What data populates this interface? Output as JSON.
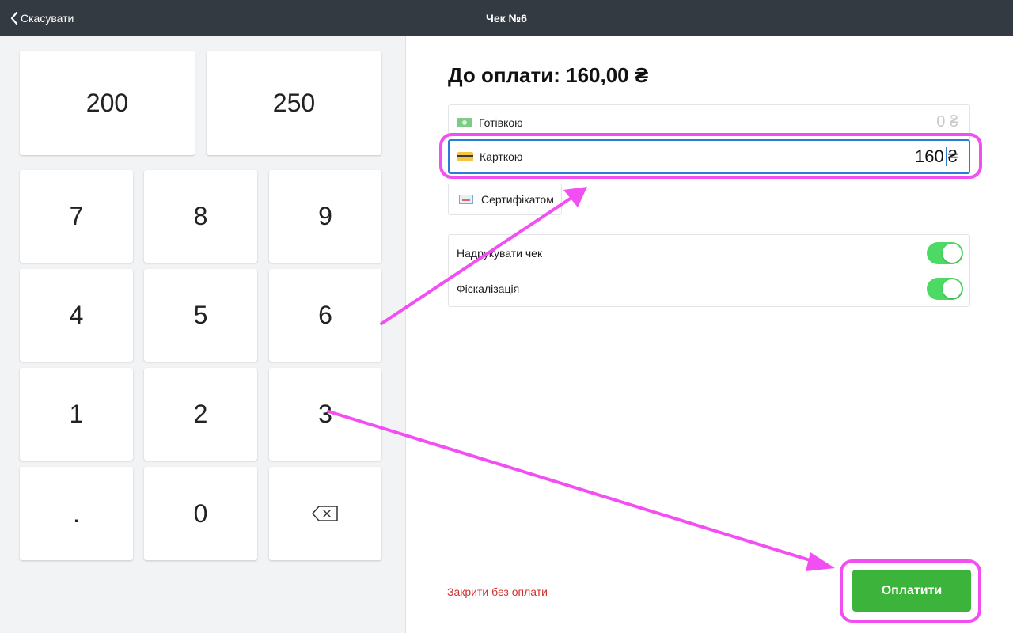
{
  "header": {
    "cancel_label": "Скасувати",
    "title": "Чек №6"
  },
  "keypad": {
    "quick_amounts": [
      "200",
      "250"
    ],
    "keys": [
      "7",
      "8",
      "9",
      "4",
      "5",
      "6",
      "1",
      "2",
      "3",
      ".",
      "0"
    ],
    "backspace_icon": "backspace-icon"
  },
  "payment": {
    "amount_due": "До оплати: 160,00 ₴",
    "methods": {
      "cash": {
        "label": "Готівкою",
        "value": "0",
        "currency": "₴",
        "icon": "cash-icon"
      },
      "card": {
        "label": "Карткою",
        "value": "160",
        "currency": "₴",
        "icon": "card-icon"
      }
    },
    "certificate": {
      "label": "Сертифікатом",
      "icon": "certificate-icon"
    }
  },
  "options": [
    {
      "label": "Надрукувати чек",
      "enabled": true
    },
    {
      "label": "Фіскалізація",
      "enabled": true
    }
  ],
  "footer": {
    "close_without_payment": "Закрити без оплати",
    "pay_label": "Оплатити"
  },
  "colors": {
    "topbar": "#343a42",
    "accent_green": "#3cb43c",
    "toggle_green": "#4cd964",
    "danger_red": "#d0312d",
    "focus_blue": "#2c7bd6",
    "annotation_magenta": "#f24ff2"
  }
}
